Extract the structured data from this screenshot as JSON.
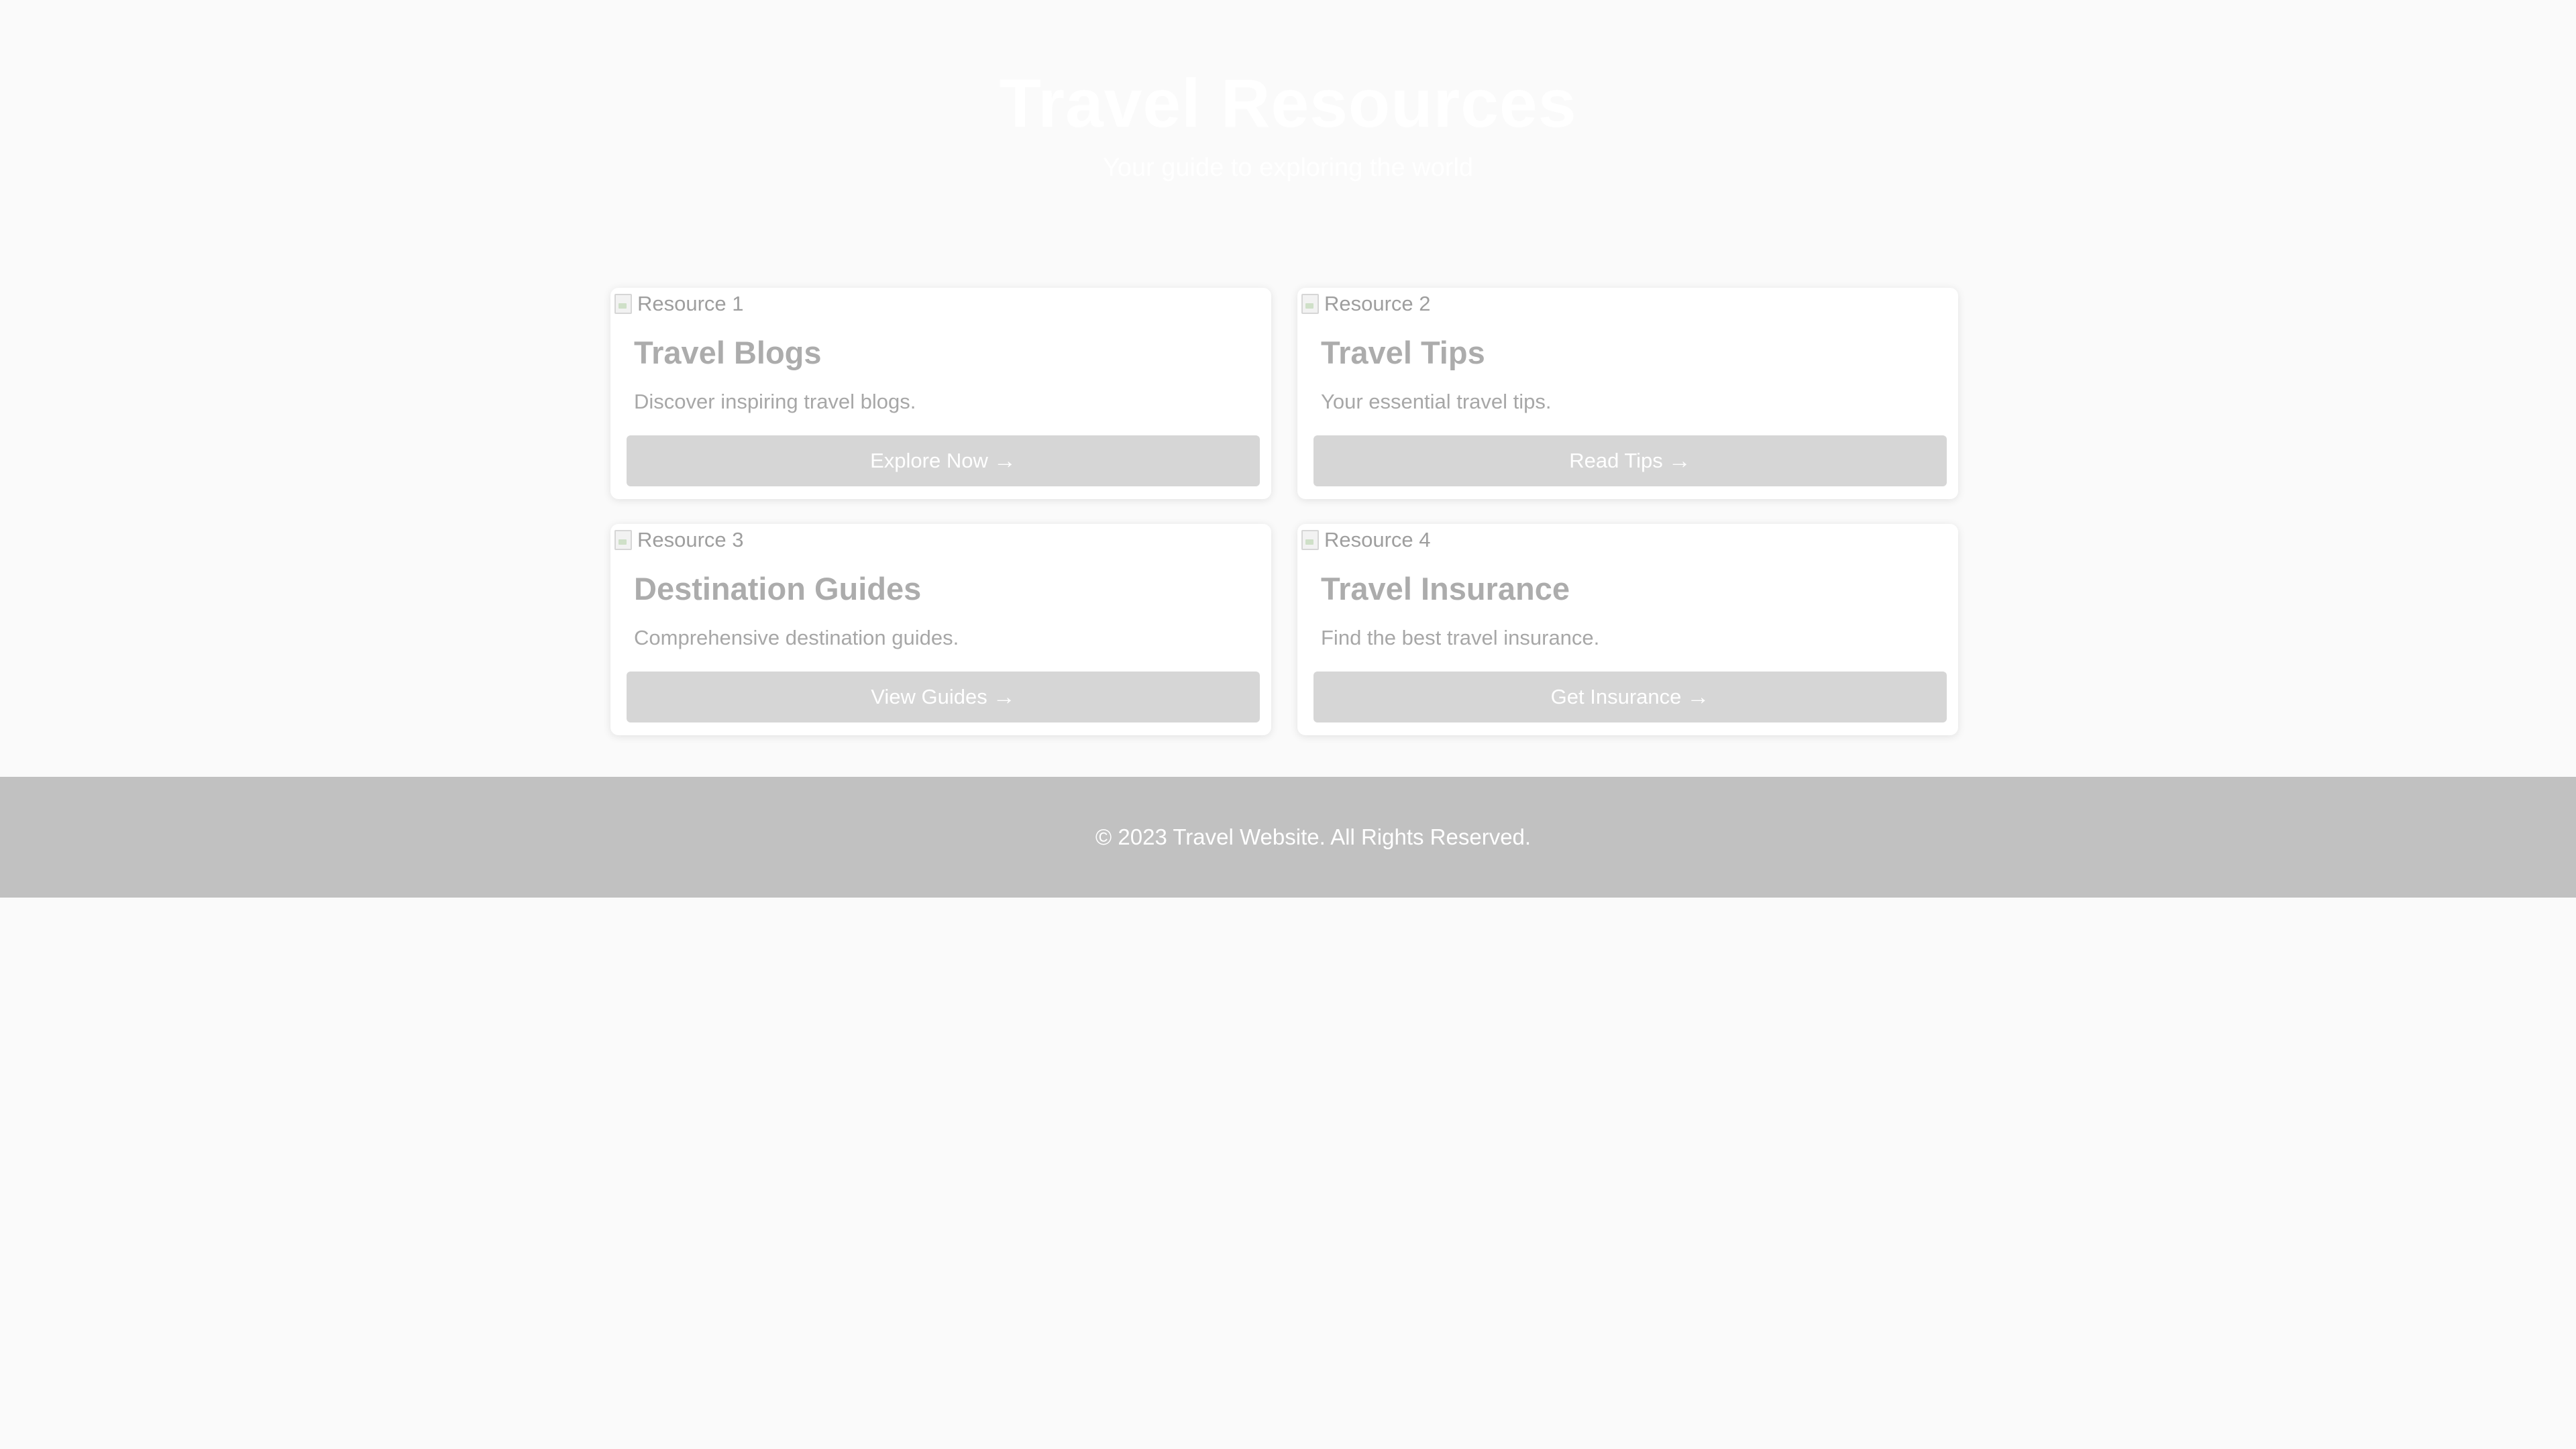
{
  "header": {
    "title": "Travel Resources",
    "subtitle": "Your guide to exploring the world"
  },
  "resources": [
    {
      "image_alt": "Resource 1",
      "title": "Travel Blogs",
      "description": "Discover inspiring travel blogs.",
      "button_label": "Explore Now"
    },
    {
      "image_alt": "Resource 2",
      "title": "Travel Tips",
      "description": "Your essential travel tips.",
      "button_label": "Read Tips"
    },
    {
      "image_alt": "Resource 3",
      "title": "Destination Guides",
      "description": "Comprehensive destination guides.",
      "button_label": "View Guides"
    },
    {
      "image_alt": "Resource 4",
      "title": "Travel Insurance",
      "description": "Find the best travel insurance.",
      "button_label": "Get Insurance"
    }
  ],
  "icons": {
    "button_icon": "arrow-right-icon",
    "image_icon": "broken-image-icon"
  },
  "footer": {
    "text": "© 2023 Travel Website. All Rights Reserved."
  },
  "colors": {
    "background": "#fafafa",
    "button": "#d6d6d6",
    "footer": "#c1c1c1",
    "card_title": "#acacac"
  }
}
